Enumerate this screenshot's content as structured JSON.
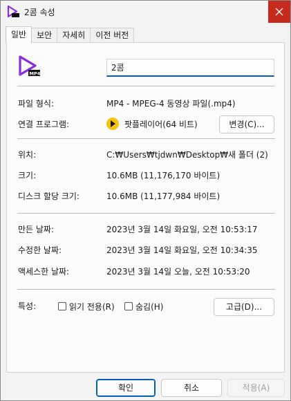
{
  "window": {
    "title": "2콤 속성"
  },
  "tabs": [
    "일반",
    "보안",
    "자세히",
    "이전 버전"
  ],
  "general": {
    "file_name": "2콤",
    "file_type_label": "파일 형식:",
    "file_type_value": "MP4 - MPEG-4 동영상 파일(.mp4)",
    "opens_with_label": "연결 프로그램:",
    "opens_with_value": "팟플레이어(64 비트)",
    "change_button": "변경(C)...",
    "location_label": "위치:",
    "location_value": "C:₩Users₩tjdwn₩Desktop₩새 폴더 (2)",
    "size_label": "크기:",
    "size_value": "10.6MB (11,176,170 바이트)",
    "size_on_disk_label": "디스크 할당 크기:",
    "size_on_disk_value": "10.6MB (11,177,984 바이트)",
    "created_label": "만든 날짜:",
    "created_value": "2023년 3월 14일 화요일, 오전 10:53:17",
    "modified_label": "수정한 날짜:",
    "modified_value": "2023년 3월 14일 화요일, 오전 10:34:35",
    "accessed_label": "액세스한 날짜:",
    "accessed_value": "2023년 3월 14일 오늘, 오전 10:53:20",
    "attributes_label": "특성:",
    "readonly_label": "읽기 전용(R)",
    "hidden_label": "숨김(H)",
    "advanced_button": "고급(D)..."
  },
  "footer": {
    "ok": "확인",
    "cancel": "취소",
    "apply": "적용(A)"
  },
  "icons": {
    "file_icon": "mp4-file-icon",
    "player_icon": "potplayer-icon",
    "close": "close-icon"
  },
  "colors": {
    "accent": "#005fb8",
    "close_bg": "#c42b1c",
    "file_icon": "#8a2be2",
    "player_icon": "#f5c211"
  }
}
